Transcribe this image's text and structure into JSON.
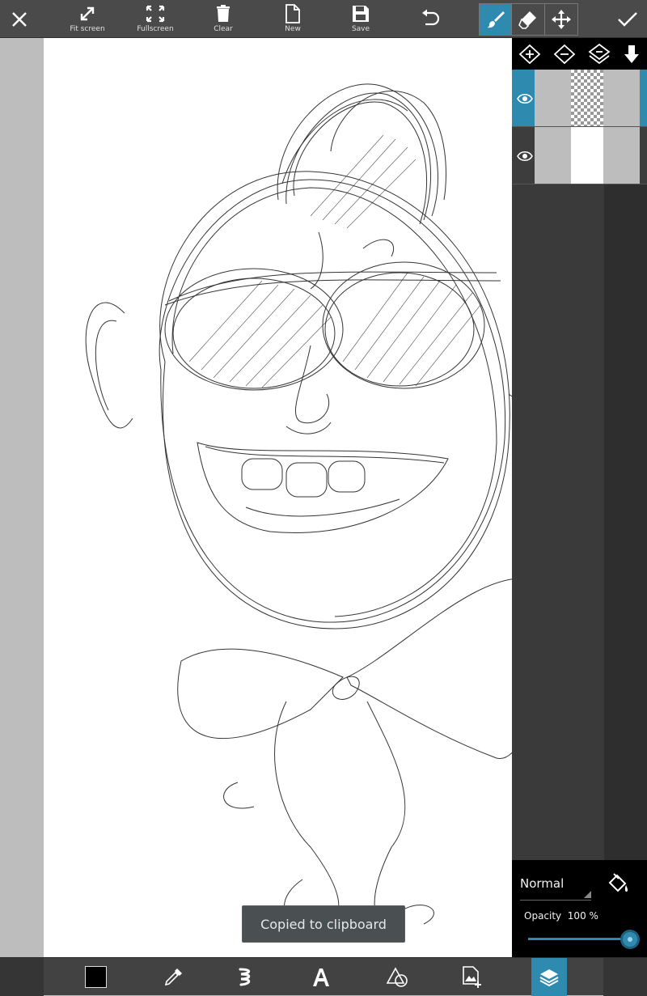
{
  "toolbar": {
    "fit_screen_label": "Fit screen",
    "fullscreen_label": "Fullscreen",
    "clear_label": "Clear",
    "new_label": "New",
    "save_label": "Save"
  },
  "tools": {
    "active": "brush",
    "items": [
      "brush-icon",
      "eraser-icon",
      "move-icon"
    ]
  },
  "layers": {
    "actions": [
      "add-layer-icon",
      "remove-layer-icon",
      "merge-layer-icon",
      "merge-down-icon"
    ],
    "items": [
      {
        "visible": true,
        "selected": true,
        "thumbnail": "transparent-sketch"
      },
      {
        "visible": true,
        "selected": false,
        "thumbnail": "white-background"
      }
    ]
  },
  "blend": {
    "mode": "Normal",
    "opacity_label": "Opacity",
    "opacity_value": "100 %",
    "opacity_fraction": 1.0
  },
  "bottom": {
    "active": "layers",
    "color": "#000000",
    "items": [
      "color-swatch",
      "eyedropper-icon",
      "brush-style-icon",
      "text-icon",
      "shapes-icon",
      "add-image-icon",
      "layers-icon"
    ]
  },
  "toast": {
    "message": "Copied to clipboard"
  },
  "colors": {
    "accent": "#2f8ab0",
    "toolbar": "#4a4a4a",
    "panel": "#3a3a3a"
  }
}
